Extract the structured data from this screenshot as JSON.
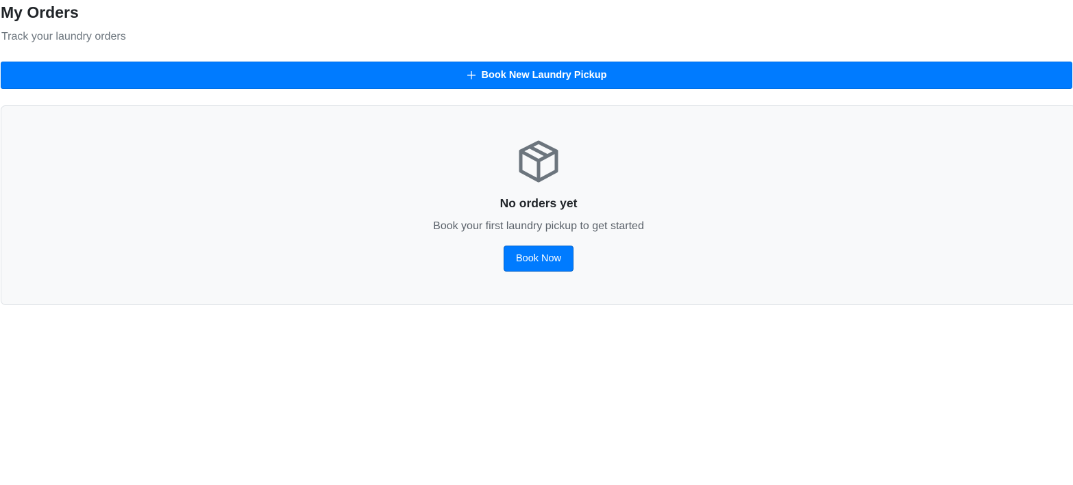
{
  "header": {
    "title": "My Orders",
    "subtitle": "Track your laundry orders"
  },
  "actions": {
    "book_new_label": "Book New Laundry Pickup",
    "book_new_icon": "plus-icon"
  },
  "empty_state": {
    "icon": "package-box-icon",
    "title": "No orders yet",
    "message": "Book your first laundry pickup to get started",
    "button_label": "Book Now"
  },
  "colors": {
    "primary": "#007bff",
    "card_background": "#f8f9fa",
    "card_border": "#dee2e6",
    "muted_text": "#6c757d",
    "icon_gray": "#6c757d"
  }
}
